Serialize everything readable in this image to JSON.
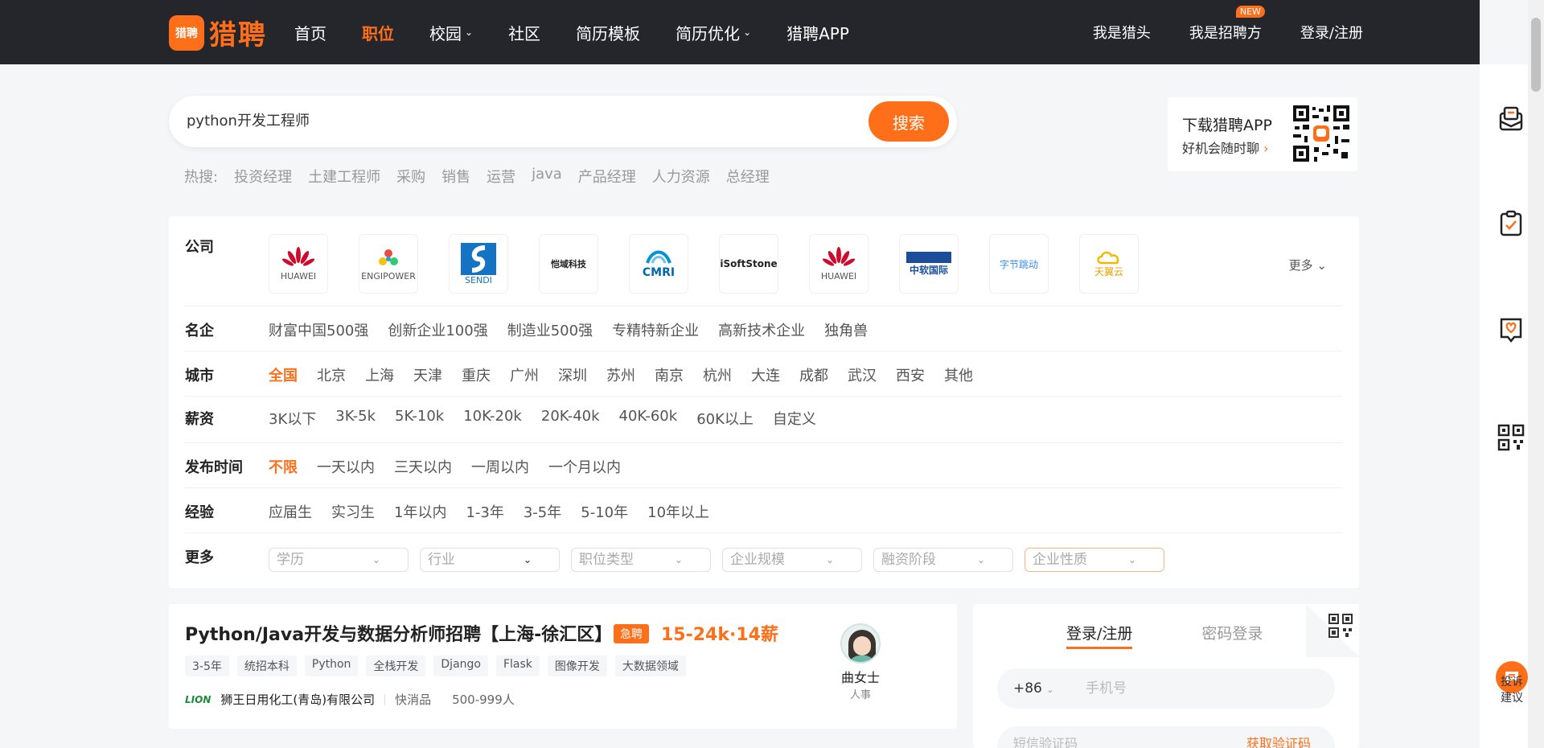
{
  "header": {
    "logo_mark": "猎聘",
    "logo_text": "猎聘",
    "nav": [
      {
        "label": "首页"
      },
      {
        "label": "职位",
        "active": true
      },
      {
        "label": "校园",
        "has_dropdown": true
      },
      {
        "label": "社区"
      },
      {
        "label": "简历模板"
      },
      {
        "label": "简历优化",
        "has_dropdown": true
      },
      {
        "label": "猎聘APP"
      }
    ],
    "right_links": [
      "我是猎头",
      "我是招聘方",
      "登录/注册"
    ],
    "new_badge": "NEW"
  },
  "search": {
    "value": "python开发工程师",
    "button": "搜索",
    "hot_label": "热搜:",
    "hot_items": [
      "投资经理",
      "土建工程师",
      "采购",
      "销售",
      "运营",
      "java",
      "产品经理",
      "人力资源",
      "总经理"
    ]
  },
  "app_promo": {
    "title": "下载猎聘APP",
    "subtitle": "好机会随时聊",
    "arrow": "›"
  },
  "filters": {
    "company": {
      "label": "公司",
      "logos": [
        "HUAWEI",
        "ENGIPOWER",
        "SENDI",
        "恺域科技",
        "CMRI",
        "iSoftStone",
        "HUAWEI",
        "中软国际",
        "字节跳动",
        "天翼云"
      ],
      "more": "更多"
    },
    "famous": {
      "label": "名企",
      "options": [
        "财富中国500强",
        "创新企业100强",
        "制造业500强",
        "专精特新企业",
        "高新技术企业",
        "独角兽"
      ]
    },
    "city": {
      "label": "城市",
      "options": [
        "全国",
        "北京",
        "上海",
        "天津",
        "重庆",
        "广州",
        "深圳",
        "苏州",
        "南京",
        "杭州",
        "大连",
        "成都",
        "武汉",
        "西安",
        "其他"
      ],
      "selected": "全国"
    },
    "salary": {
      "label": "薪资",
      "options": [
        "3K以下",
        "3K-5k",
        "5K-10k",
        "10K-20k",
        "20K-40k",
        "40K-60k",
        "60K以上",
        "自定义"
      ]
    },
    "publish": {
      "label": "发布时间",
      "options": [
        "不限",
        "一天以内",
        "三天以内",
        "一周以内",
        "一个月以内"
      ],
      "selected": "不限"
    },
    "experience": {
      "label": "经验",
      "options": [
        "应届生",
        "实习生",
        "1年以内",
        "1-3年",
        "3-5年",
        "5-10年",
        "10年以上"
      ]
    },
    "more": {
      "label": "更多",
      "dropdowns": [
        "学历",
        "行业",
        "职位类型",
        "企业规模",
        "融资阶段",
        "企业性质"
      ]
    }
  },
  "job": {
    "title": "Python/Java开发与数据分析师招聘【上海-徐汇区】",
    "urgent": "急聘",
    "salary": "15-24k·14薪",
    "tags": [
      "3-5年",
      "统招本科",
      "Python",
      "全栈开发",
      "Django",
      "Flask",
      "图像开发",
      "大数据领域"
    ],
    "company_logo": "LION",
    "company": "狮王日用化工(青岛)有限公司",
    "industry": "快消品",
    "size": "500-999人",
    "recruiter_name": "曲女士",
    "recruiter_role": "人事"
  },
  "login": {
    "tabs": [
      "登录/注册",
      "密码登录"
    ],
    "country_code": "+86",
    "phone_placeholder": "手机号",
    "code_placeholder": "短信验证码",
    "get_code": "获取验证码"
  },
  "side": {
    "feedback": "投诉建议"
  }
}
